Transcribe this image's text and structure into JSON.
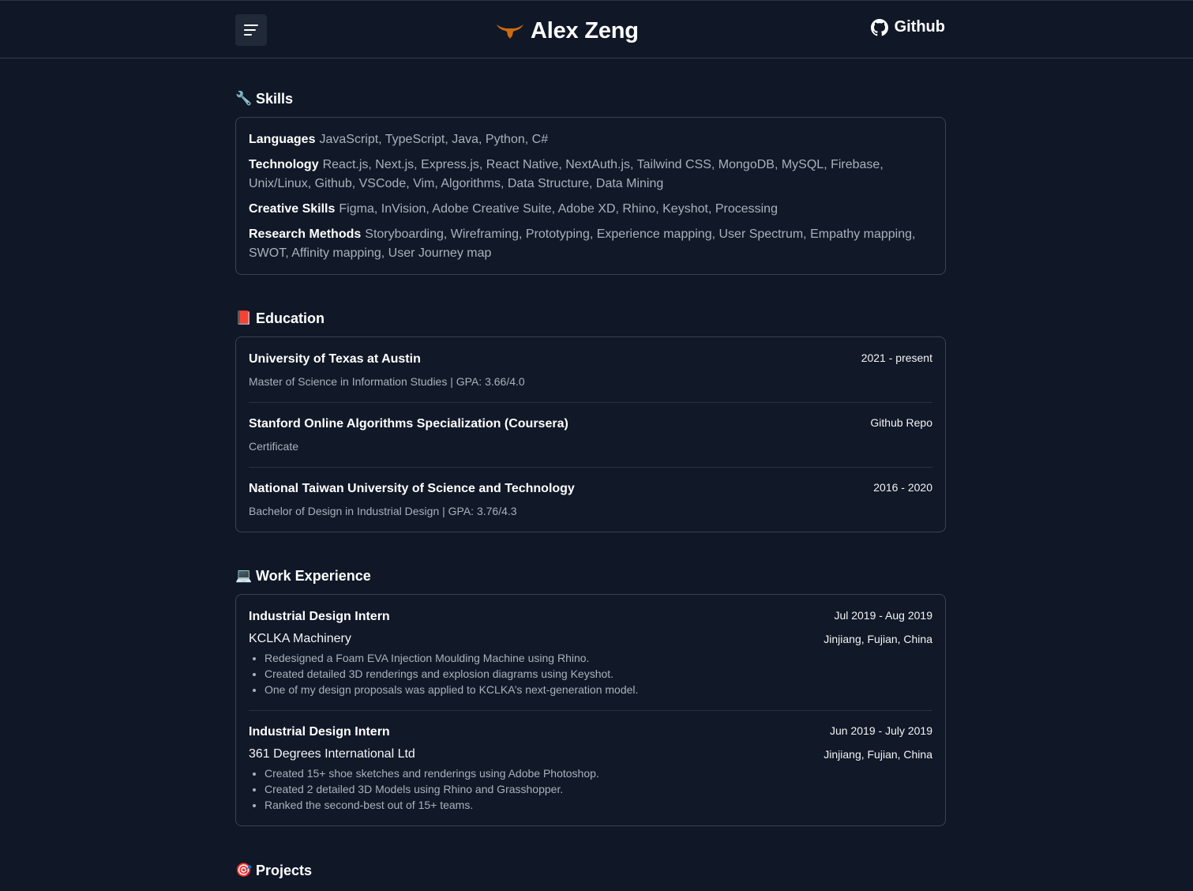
{
  "header": {
    "brand_name": "Alex Zeng",
    "github_label": "Github",
    "colors": {
      "longhorn": "#cc6a13",
      "background": "#101827"
    }
  },
  "skills": {
    "title": "Skills",
    "emoji": "🔧",
    "rows": [
      {
        "label": "Languages",
        "value": "JavaScript, TypeScript, Java, Python, C#"
      },
      {
        "label": "Technology",
        "value": "React.js, Next.js, Express.js, React Native, NextAuth.js, Tailwind CSS, MongoDB, MySQL, Firebase, Unix/Linux, Github, VSCode, Vim, Algorithms, Data Structure, Data Mining"
      },
      {
        "label": "Creative Skills",
        "value": "Figma, InVision, Adobe Creative Suite, Adobe XD, Rhino, Keyshot, Processing"
      },
      {
        "label": "Research Methods",
        "value": "Storyboarding, Wireframing, Prototyping, Experience mapping, User Spectrum, Empathy mapping, SWOT, Affinity mapping, User Journey map"
      }
    ]
  },
  "education": {
    "title": "Education",
    "emoji": "📕",
    "items": [
      {
        "school": "University of Texas at Austin",
        "right": "2021 - present",
        "detail": "Master of Science in Information Studies | GPA: 3.66/4.0"
      },
      {
        "school": "Stanford Online Algorithms Specialization (Coursera)",
        "right": "Github Repo",
        "detail": "Certificate"
      },
      {
        "school": "National Taiwan University of Science and Technology",
        "right": "2016 - 2020",
        "detail": "Bachelor of Design in Industrial Design | GPA: 3.76/4.3"
      }
    ]
  },
  "work": {
    "title": "Work Experience",
    "emoji": "💻",
    "items": [
      {
        "role": "Industrial Design Intern",
        "dates": "Jul 2019 - Aug 2019",
        "company": "KCLKA Machinery",
        "location": "Jinjiang, Fujian, China",
        "bullets": [
          "Redesigned a Foam EVA Injection Moulding Machine using Rhino.",
          "Created detailed 3D renderings and explosion diagrams using Keyshot.",
          "One of my design proposals was applied to KCLKA’s next-generation model."
        ]
      },
      {
        "role": "Industrial Design Intern",
        "dates": "Jun 2019 - July 2019",
        "company": "361 Degrees International Ltd",
        "location": "Jinjiang, Fujian, China",
        "bullets": [
          "Created 15+ shoe sketches and renderings using Adobe Photoshop.",
          "Created 2 detailed 3D Models using Rhino and Grasshopper.",
          "Ranked the second-best out of 15+ teams."
        ]
      }
    ]
  },
  "projects": {
    "title": "Projects",
    "emoji": "🎯"
  }
}
